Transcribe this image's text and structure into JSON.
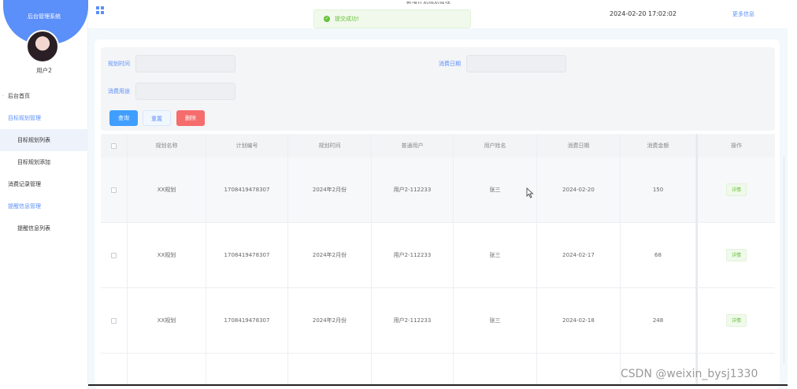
{
  "sidebar": {
    "app_title": "后台管理系统",
    "user_name": "用户2",
    "menu": [
      {
        "label": "后台首页"
      },
      {
        "label": "目标规划管理"
      },
      {
        "label": "目标规划列表"
      },
      {
        "label": "目标规划添加"
      },
      {
        "label": "消费记录管理"
      },
      {
        "label": "提醒信息管理"
      },
      {
        "label": "提醒信息列表"
      }
    ]
  },
  "topbar": {
    "clipped_text": "新增计划规划管理",
    "datetime": "2024-02-20 17:02:02",
    "more_link": "更多信息"
  },
  "toast": {
    "message": "提交成功!"
  },
  "form": {
    "plan_time_label": "规划时间",
    "consume_date_label": "消费日期",
    "consume_use_label": "消费用途",
    "query_label": "查询",
    "reset_label": "重置",
    "delete_label": "删除"
  },
  "table": {
    "headers": [
      "规划名称",
      "计划编号",
      "规划时间",
      "普通用户",
      "用户姓名",
      "消费日期",
      "消费金额",
      "操作"
    ],
    "rows": [
      {
        "name": "XX规划",
        "code": "1708419478307",
        "time": "2024年2月份",
        "user": "用户2-112233",
        "real_name": "张三",
        "date": "2024-02-20",
        "amount": "150",
        "action": "详情"
      },
      {
        "name": "XX规划",
        "code": "1708419478307",
        "time": "2024年2月份",
        "user": "用户2-112233",
        "real_name": "张三",
        "date": "2024-02-17",
        "amount": "68",
        "action": "详情"
      },
      {
        "name": "XX规划",
        "code": "1708419478307",
        "time": "2024年2月份",
        "user": "用户2-112233",
        "real_name": "张三",
        "date": "2024-02-18",
        "amount": "248",
        "action": "详情"
      }
    ]
  },
  "watermark": "CSDN @weixin_bysj1330",
  "icons": {
    "menu_grid": "grid-icon",
    "toast_ok": "check-circle-icon",
    "cursor": "mouse-pointer-icon"
  },
  "colors": {
    "accent": "#5b8ff9",
    "success": "#67c23a",
    "danger": "#f56c6c",
    "primary_button": "#409eff"
  }
}
